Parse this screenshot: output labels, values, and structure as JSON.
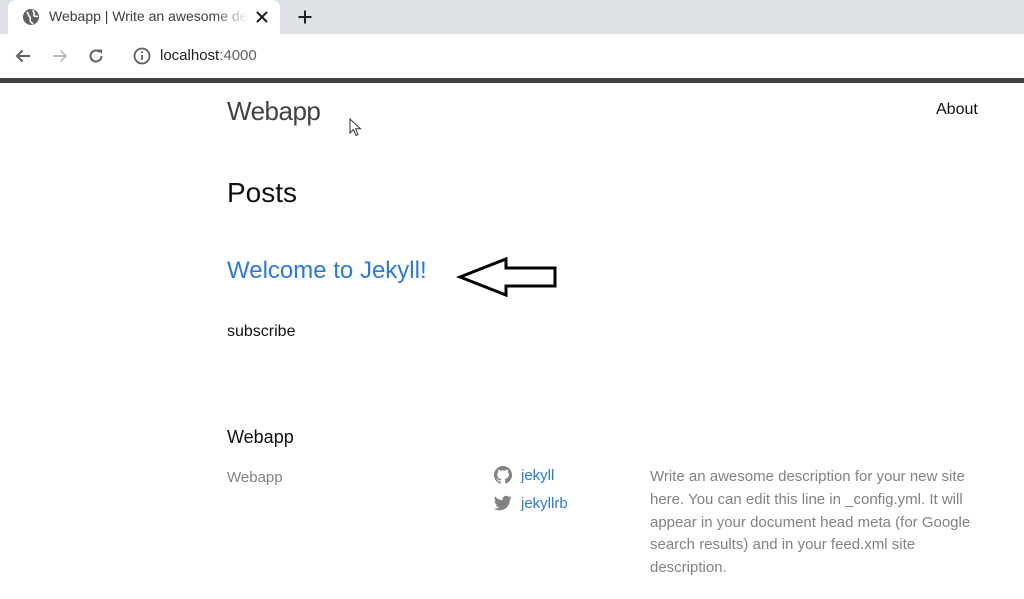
{
  "browser": {
    "tab_title": "Webapp | Write an awesome description for your new site",
    "new_tab_label": "+",
    "url_host": "localhost",
    "url_port": ":4000"
  },
  "site": {
    "title": "Webapp",
    "nav": {
      "about": "About"
    }
  },
  "main": {
    "heading": "Posts",
    "posts": [
      {
        "title": "Welcome to Jekyll!"
      }
    ],
    "subscribe_label": "subscribe"
  },
  "footer": {
    "heading": "Webapp",
    "name": "Webapp",
    "github_username": "jekyll",
    "twitter_username": "jekyllrb",
    "description": "Write an awesome description for your new site here. You can edit this line in _config.yml. It will appear in your document head meta (for Google search results) and in your feed.xml site description."
  },
  "colors": {
    "link": "#2a7ae2",
    "footer_text": "#828282",
    "header_line": "#424242"
  },
  "icons": {
    "tab_favicon": "globe-icon",
    "github": "github-icon",
    "twitter": "twitter-icon",
    "annotation": "arrow-left-icon"
  }
}
